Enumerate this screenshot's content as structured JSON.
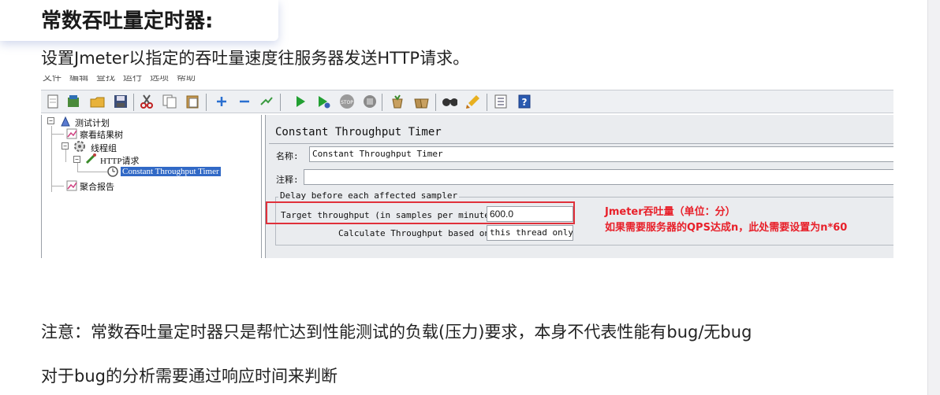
{
  "heading": "常数吞吐量定时器:",
  "subtitle": "设置Jmeter以指定的吞吐量速度往服务器发送HTTP请求。",
  "screenshot": {
    "menu": [
      "文件",
      "编辑",
      "查找",
      "运行",
      "选项",
      "帮助"
    ],
    "toolbar_icons": [
      "new-icon",
      "templates-icon",
      "open-icon",
      "save-icon",
      "cut-icon",
      "copy-icon",
      "paste-icon",
      "expand-icon",
      "collapse-icon",
      "toggle-icon",
      "start-icon",
      "start-no-pause-icon",
      "stop-icon",
      "shutdown-icon",
      "clear-icon",
      "clear-all-icon",
      "search-icon",
      "reset-search-icon",
      "function-helper-icon",
      "help-icon"
    ],
    "tree": {
      "test_plan": "测试计划",
      "view_results": "察看结果树",
      "thread_group": "线程组",
      "http_request": "HTTP请求",
      "timer": "Constant Throughput Timer",
      "aggregate_report": "聚合报告"
    },
    "panel": {
      "title": "Constant Throughput Timer",
      "name_label": "名称:",
      "name_value": "Constant Throughput Timer",
      "comment_label": "注释:",
      "comment_value": "",
      "group_legend": "Delay before each affected sampler",
      "throughput_label": "Target throughput (in samples per minute):",
      "throughput_value": "600.0",
      "calc_label": "Calculate Throughput based on:",
      "calc_value": "this thread only"
    },
    "annotations": {
      "line1": "Jmeter吞吐量（单位：分）",
      "line2": "如果需要服务器的QPS达成n，此处需要设置为n*60"
    }
  },
  "note1": "注意：常数吞吐量定时器只是帮忙达到性能测试的负载(压力)要求，本身不代表性能有bug/无bug",
  "note2": "对于bug的分析需要通过响应时间来判断",
  "colors": {
    "annotation": "#e8202a",
    "selection": "#3169c6",
    "highlight_box": "#e0303a"
  }
}
